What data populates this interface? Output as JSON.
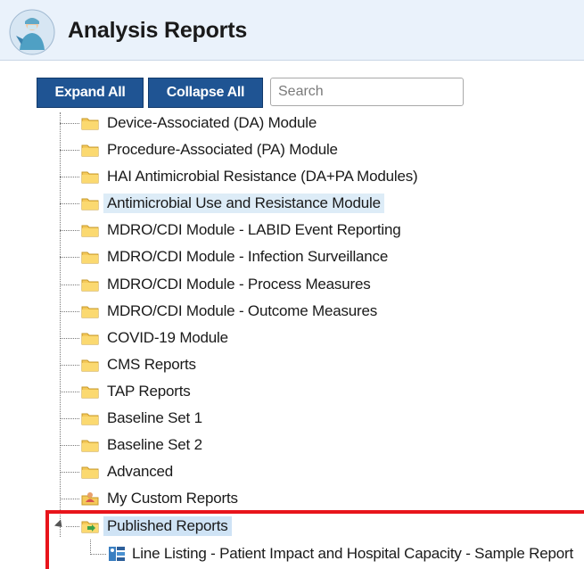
{
  "header": {
    "title": "Analysis Reports",
    "logo_icon": "nurse-logo-icon"
  },
  "toolbar": {
    "expand_all": "Expand All",
    "collapse_all": "Collapse All",
    "search_placeholder": "Search",
    "button_color": "#1f5493"
  },
  "tree": {
    "items": [
      {
        "label": "Device-Associated (DA) Module"
      },
      {
        "label": "Procedure-Associated (PA) Module"
      },
      {
        "label": "HAI Antimicrobial Resistance (DA+PA Modules)"
      },
      {
        "label": "Antimicrobial Use and Resistance Module",
        "state": "highlighted"
      },
      {
        "label": "MDRO/CDI Module - LABID Event Reporting"
      },
      {
        "label": "MDRO/CDI Module - Infection Surveillance"
      },
      {
        "label": "MDRO/CDI Module - Process Measures"
      },
      {
        "label": "MDRO/CDI Module - Outcome Measures"
      },
      {
        "label": "COVID-19 Module"
      },
      {
        "label": "CMS Reports"
      },
      {
        "label": "TAP Reports"
      },
      {
        "label": "Baseline Set 1"
      },
      {
        "label": "Baseline Set 2"
      },
      {
        "label": "Advanced"
      },
      {
        "label": "My Custom Reports",
        "icon": "person-folder-icon"
      },
      {
        "label": "Published Reports",
        "icon": "published-folder-icon",
        "state": "expanded"
      }
    ],
    "published_child": {
      "label": "Line Listing - Patient Impact and Hospital Capacity - Sample Report",
      "icon": "line-listing-report-icon"
    }
  },
  "annotation": {
    "color": "#e8141b"
  }
}
